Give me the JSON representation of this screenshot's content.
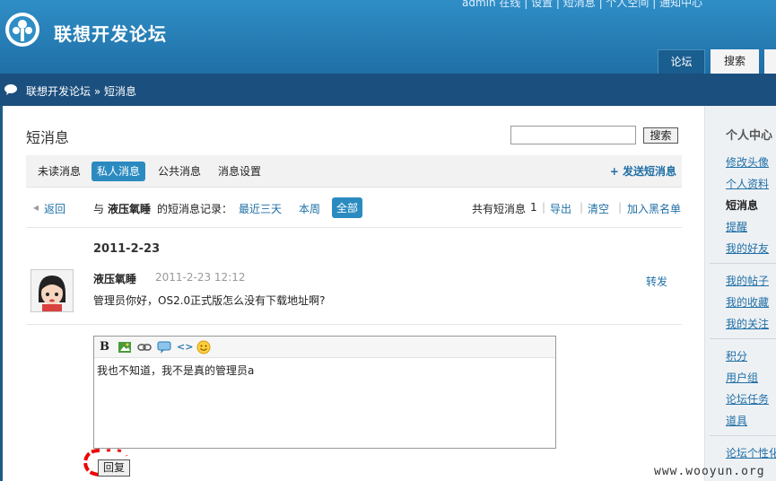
{
  "header": {
    "top_links": "admin  在线 | 设置 | 短消息 | 个人空间 | 通知中心",
    "site_title": "联想开发论坛",
    "tabs": [
      {
        "label": "论坛"
      },
      {
        "label": "搜索"
      }
    ]
  },
  "breadcrumb": {
    "text": "联想开发论坛 » 短消息"
  },
  "main": {
    "page_title": "短消息",
    "search_button": "搜索",
    "subtabs": [
      {
        "label": "未读消息"
      },
      {
        "label": "私人消息"
      },
      {
        "label": "公共消息"
      },
      {
        "label": "消息设置"
      }
    ],
    "send_link": "+ 发送短消息",
    "back": "返回",
    "with_prefix": "与",
    "with_user": "液压氧睡",
    "with_suffix": "的短消息记录：",
    "filters": [
      "最近三天",
      "本周",
      "全部"
    ],
    "total_label": "共有短消息",
    "total_count": "1",
    "export": "导出",
    "clear": "清空",
    "blacklist": "加入黑名单"
  },
  "message": {
    "date": "2011-2-23",
    "user": "液压氧睡",
    "time": "2011-2-23 12:12",
    "forward": "转发",
    "body": "管理员你好，OS2.0正式版怎么没有下载地址啊?"
  },
  "editor": {
    "text": "我也不知道，我不是真的管理员a",
    "reply_button": "回复"
  },
  "sidebar": {
    "title": "个人中心",
    "items": [
      {
        "label": "修改头像"
      },
      {
        "label": "个人资料"
      },
      {
        "label": "短消息"
      },
      {
        "label": "提醒"
      },
      {
        "label": "我的好友"
      },
      {
        "label": "我的帖子"
      },
      {
        "label": "我的收藏"
      },
      {
        "label": "我的关注"
      },
      {
        "label": "积分"
      },
      {
        "label": "用户组"
      },
      {
        "label": "论坛任务"
      },
      {
        "label": "道具"
      },
      {
        "label": "论坛个性化"
      }
    ]
  },
  "watermark": "www.wooyun.org"
}
